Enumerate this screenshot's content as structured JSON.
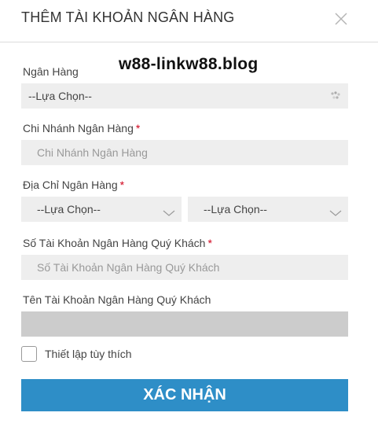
{
  "dialog": {
    "title": "THÊM TÀI KHOẢN NGÂN HÀNG"
  },
  "watermark": "w88-linkw88.blog",
  "form": {
    "bank": {
      "label": "Ngân Hàng",
      "value": "--Lựa Chọn--"
    },
    "branch": {
      "label": "Chi Nhánh Ngân Hàng",
      "required_mark": "*",
      "placeholder": "Chi Nhánh Ngân Hàng"
    },
    "address": {
      "label": "Địa Chỉ Ngân Hàng",
      "required_mark": "*",
      "select1_value": "--Lựa Chọn--",
      "select2_value": "--Lựa Chọn--"
    },
    "account_number": {
      "label": "Số Tài Khoản Ngân Hàng Quý Khách",
      "required_mark": "*",
      "placeholder": "Số Tài Khoản Ngân Hàng Quý Khách"
    },
    "account_name": {
      "label": "Tên Tài Khoản Ngân Hàng Quý Khách",
      "value": ""
    },
    "custom_setting": {
      "label": "Thiết lập tùy thích",
      "checked": false
    },
    "submit_label": "XÁC NHẬN"
  },
  "colors": {
    "accent": "#2e8ec7",
    "required": "#d0021b",
    "field_bg": "#eeeeee",
    "disabled_bg": "#cccccc"
  }
}
